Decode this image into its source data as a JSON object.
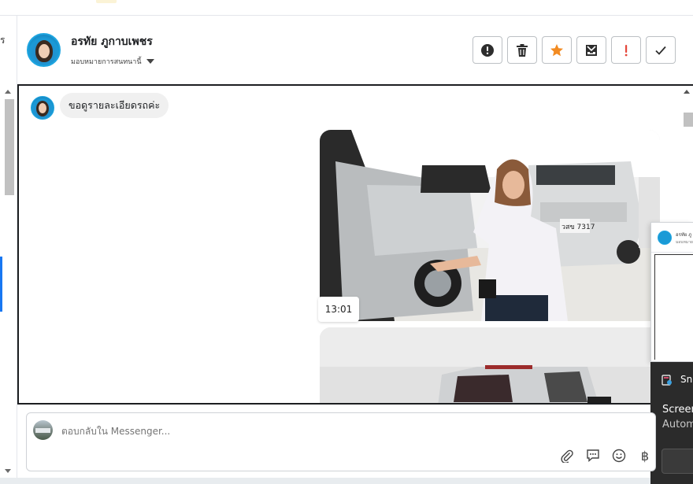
{
  "header": {
    "contact_name": "อรทัย ภูกาบเพชร",
    "assign_label": "มอบหมายการสนทนานี้",
    "actions": [
      {
        "icon": "alert-circle-icon",
        "label": "Mark as spam"
      },
      {
        "icon": "trash-icon",
        "label": "Delete"
      },
      {
        "icon": "star-icon",
        "label": "Star",
        "color": "#f28b22"
      },
      {
        "icon": "archive-icon",
        "label": "Archive"
      },
      {
        "icon": "exclamation-icon",
        "label": "Follow up",
        "color": "#e4463a"
      },
      {
        "icon": "checkmark-icon",
        "label": "Done"
      }
    ]
  },
  "left": {
    "fragment": "ร"
  },
  "chat": {
    "incoming_message": "ขอดูรายละเอียดรถค่ะ",
    "video_timestamp": "13:01",
    "media1_caption": "วสข 7317"
  },
  "reply": {
    "placeholder": "ตอบกลับใน Messenger...",
    "icons": [
      "paperclip-icon",
      "saved-replies-icon",
      "emoji-icon",
      "baht-icon"
    ],
    "baht_symbol": "฿"
  },
  "popup": {
    "title": "อรทัย ภู",
    "subtitle": "มอบหมายการ"
  },
  "toast": {
    "app_name": "Sni",
    "line1": "Screen",
    "line2": "Autom"
  },
  "colors": {
    "accent_blue": "#1877f2",
    "star_orange": "#f28b22",
    "flag_red": "#e4463a"
  }
}
